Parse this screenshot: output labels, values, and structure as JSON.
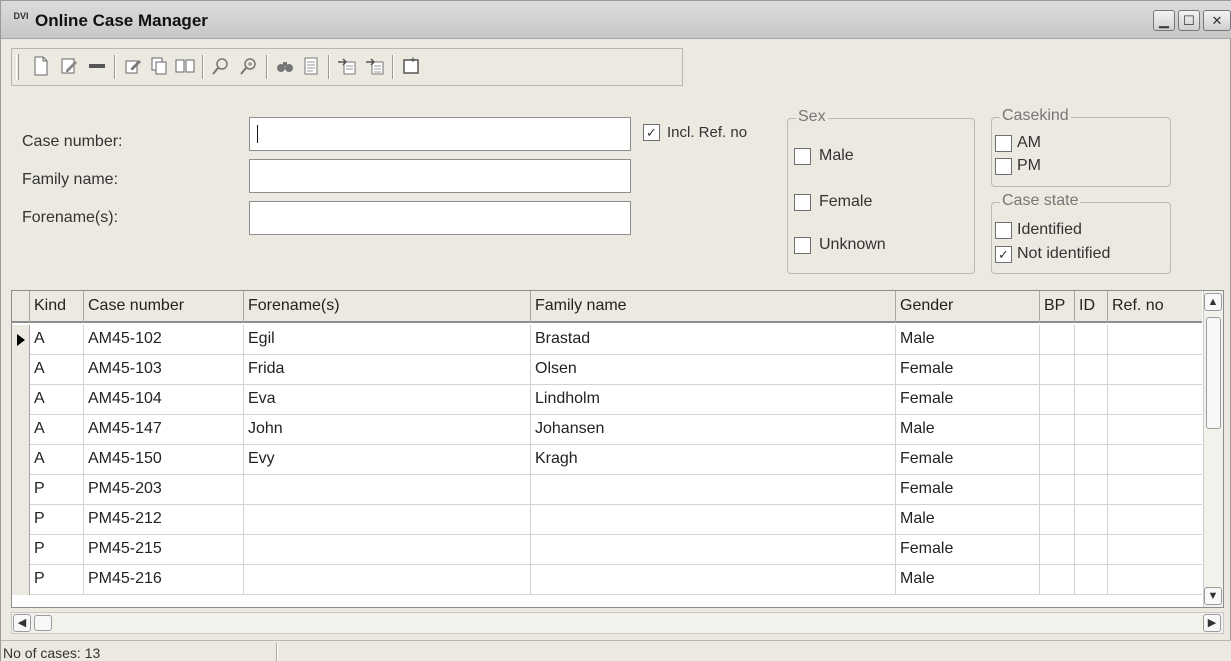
{
  "window": {
    "title": "Online Case Manager",
    "app_icon_text": "DVI",
    "controls": [
      "minimize",
      "maximize",
      "close"
    ]
  },
  "toolbar": {
    "icons": [
      "new-document-icon",
      "edit-icon",
      "remove-icon",
      "edit-record-icon",
      "copy-icon",
      "open-book-icon",
      "search-icon",
      "search-advanced-icon",
      "print-preview-icon",
      "report-icon",
      "export-icon",
      "import-icon",
      "new-window-icon"
    ]
  },
  "search": {
    "case_number_label": "Case number:",
    "family_name_label": "Family name:",
    "forenames_label": "Forename(s):",
    "case_number_value": "",
    "family_name_value": "",
    "forenames_value": "",
    "incl_ref_label": "Incl. Ref. no",
    "incl_ref_checked": true
  },
  "sex": {
    "legend": "Sex",
    "options": [
      {
        "label": "Male",
        "checked": false
      },
      {
        "label": "Female",
        "checked": false
      },
      {
        "label": "Unknown",
        "checked": false
      }
    ]
  },
  "casekind": {
    "legend": "Casekind",
    "options": [
      {
        "label": "AM",
        "checked": false
      },
      {
        "label": "PM",
        "checked": false
      }
    ]
  },
  "casestate": {
    "legend": "Case state",
    "options": [
      {
        "label": "Identified",
        "checked": false
      },
      {
        "label": "Not identified",
        "checked": true
      }
    ]
  },
  "grid": {
    "columns": [
      "Kind",
      "Case number",
      "Forename(s)",
      "Family name",
      "Gender",
      "BP",
      "ID",
      "Ref. no"
    ],
    "rows": [
      [
        "A",
        "AM45-102",
        "Egil",
        "Brastad",
        "Male",
        "",
        "",
        ""
      ],
      [
        "A",
        "AM45-103",
        "Frida",
        "Olsen",
        "Female",
        "",
        "",
        ""
      ],
      [
        "A",
        "AM45-104",
        "Eva",
        "Lindholm",
        "Female",
        "",
        "",
        ""
      ],
      [
        "A",
        "AM45-147",
        "John",
        "Johansen",
        "Male",
        "",
        "",
        ""
      ],
      [
        "A",
        "AM45-150",
        "Evy",
        "Kragh",
        "Female",
        "",
        "",
        ""
      ],
      [
        "P",
        "PM45-203",
        "",
        "",
        "Female",
        "",
        "",
        ""
      ],
      [
        "P",
        "PM45-212",
        "",
        "",
        "Male",
        "",
        "",
        ""
      ],
      [
        "P",
        "PM45-215",
        "",
        "",
        "Female",
        "",
        "",
        ""
      ],
      [
        "P",
        "PM45-216",
        "",
        "",
        "Male",
        "",
        "",
        ""
      ]
    ],
    "selected_row": 0
  },
  "status": {
    "text": "No of cases: 13"
  }
}
